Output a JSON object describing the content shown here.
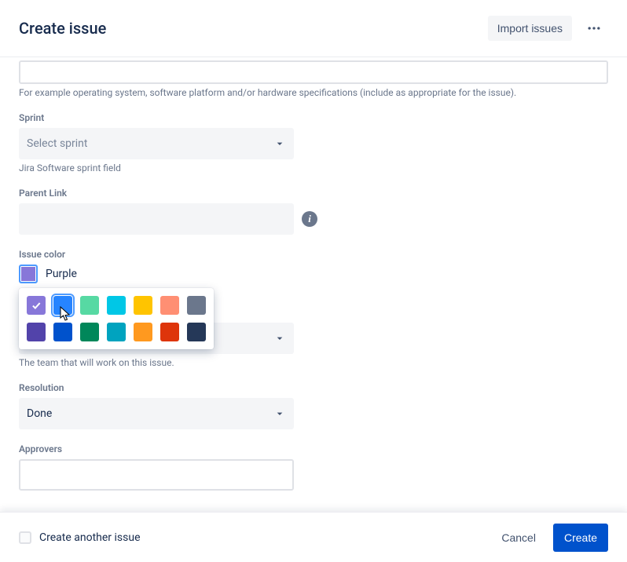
{
  "header": {
    "title": "Create issue",
    "import_label": "Import issues"
  },
  "environment": {
    "help": "For example operating system, software platform and/or hardware specifications (include as appropriate for the issue)."
  },
  "sprint": {
    "label": "Sprint",
    "placeholder": "Select sprint",
    "help": "Jira Software sprint field"
  },
  "parent": {
    "label": "Parent Link"
  },
  "issueColor": {
    "label": "Issue color",
    "selected_name": "Purple",
    "selected_hex": "#8777D9",
    "palette": [
      {
        "name": "purple-light",
        "hex": "#8777D9",
        "checked": true
      },
      {
        "name": "blue-light",
        "hex": "#2684FF",
        "focused": true
      },
      {
        "name": "green-light",
        "hex": "#57D9A3"
      },
      {
        "name": "teal-light",
        "hex": "#00C7E6"
      },
      {
        "name": "yellow",
        "hex": "#FFC400"
      },
      {
        "name": "coral",
        "hex": "#FF8F73"
      },
      {
        "name": "gray",
        "hex": "#6B778C"
      },
      {
        "name": "purple-dark",
        "hex": "#5243AA"
      },
      {
        "name": "blue-dark",
        "hex": "#0052CC"
      },
      {
        "name": "green-dark",
        "hex": "#00875A"
      },
      {
        "name": "teal-dark",
        "hex": "#00A3BF"
      },
      {
        "name": "orange",
        "hex": "#FF991F"
      },
      {
        "name": "red",
        "hex": "#DE350B"
      },
      {
        "name": "navy",
        "hex": "#253858"
      }
    ]
  },
  "team": {
    "help": "The team that will work on this issue."
  },
  "resolution": {
    "label": "Resolution",
    "value": "Done"
  },
  "approvers": {
    "label": "Approvers"
  },
  "footer": {
    "create_another": "Create another issue",
    "cancel": "Cancel",
    "create": "Create"
  }
}
